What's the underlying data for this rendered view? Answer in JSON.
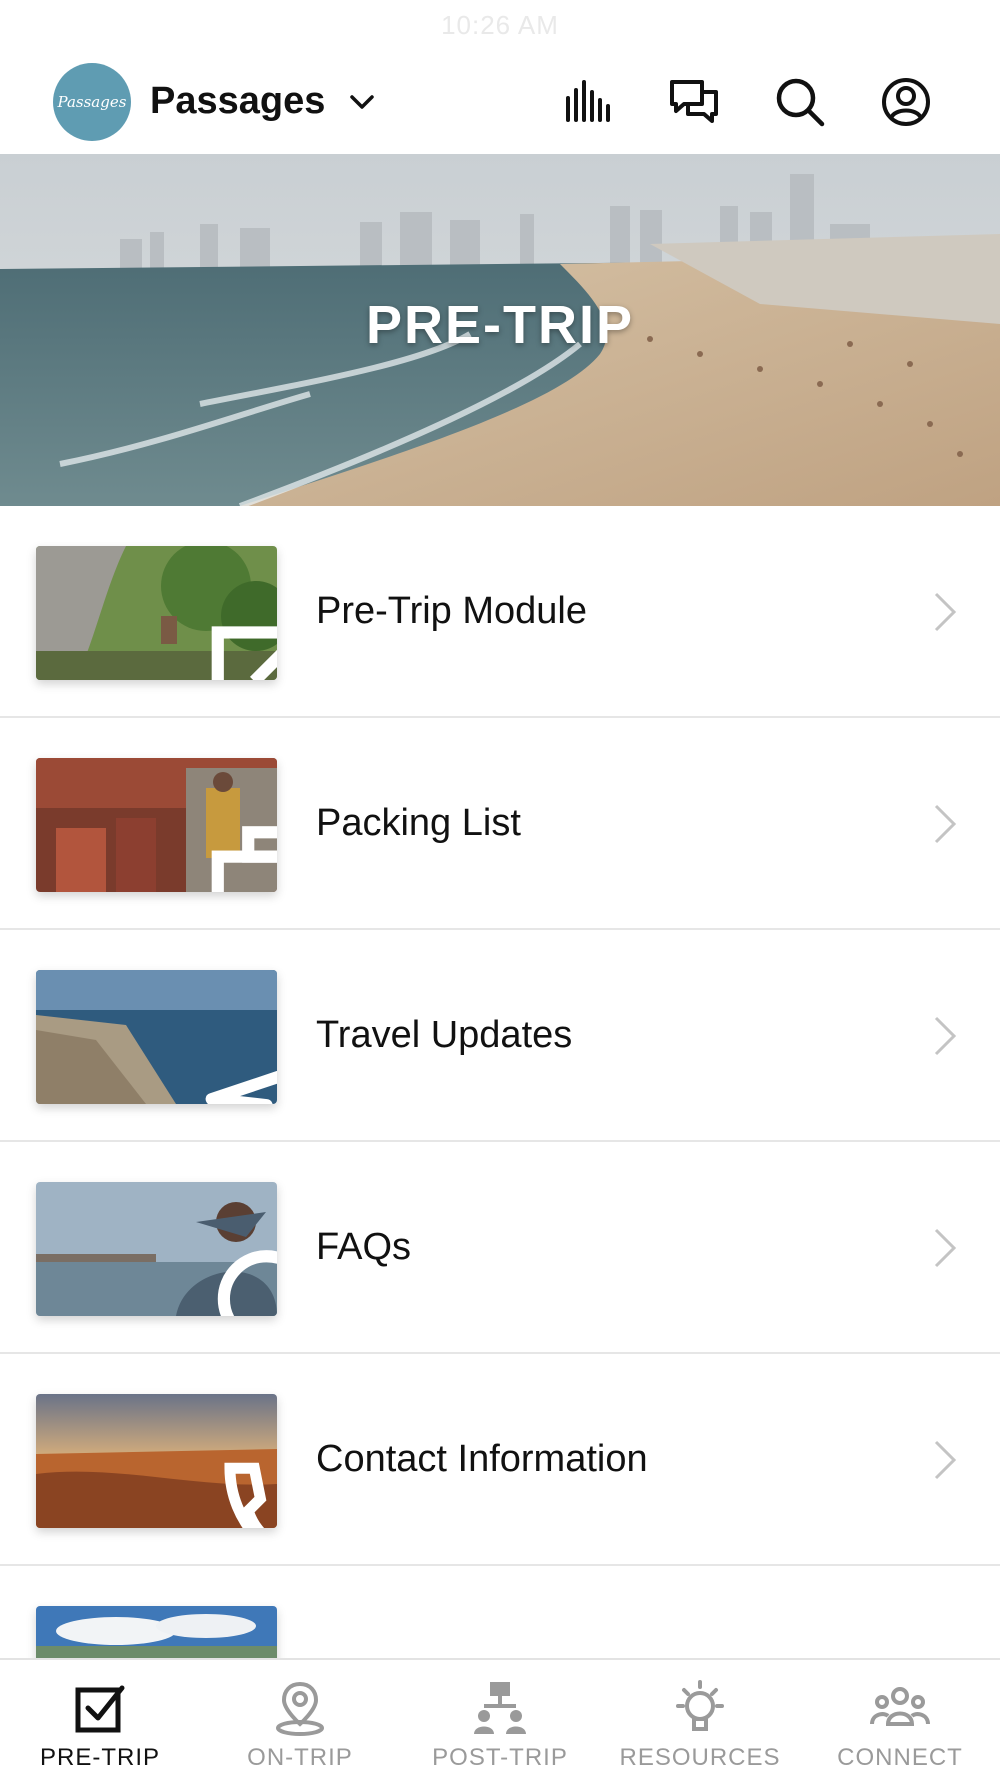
{
  "status_bar": {
    "time": "10:26 AM"
  },
  "header": {
    "logo_text": "Passages",
    "brand": "Passages",
    "icons": [
      "stats-icon",
      "chat-icon",
      "search-icon",
      "profile-icon"
    ]
  },
  "hero": {
    "title": "PRE-TRIP"
  },
  "list": {
    "items": [
      {
        "label": "Pre-Trip Module",
        "icon": "edit-icon"
      },
      {
        "label": "Packing List",
        "icon": "briefcase-icon"
      },
      {
        "label": "Travel Updates",
        "icon": "airplane-icon"
      },
      {
        "label": "FAQs",
        "icon": "chat-bubble-icon"
      },
      {
        "label": "Contact Information",
        "icon": "phone-icon"
      },
      {
        "label": "",
        "icon": ""
      }
    ]
  },
  "tabs": [
    {
      "label": "PRE-TRIP",
      "icon": "checkbox-icon",
      "active": true
    },
    {
      "label": "ON-TRIP",
      "icon": "location-pin-icon",
      "active": false
    },
    {
      "label": "POST-TRIP",
      "icon": "network-icon",
      "active": false
    },
    {
      "label": "RESOURCES",
      "icon": "lightbulb-icon",
      "active": false
    },
    {
      "label": "CONNECT",
      "icon": "group-icon",
      "active": false
    }
  ],
  "colors": {
    "logo_bg": "#5f9cb2",
    "active_tab": "#111111",
    "inactive_tab": "#9a9a9a",
    "divider": "#e6e6e6"
  }
}
